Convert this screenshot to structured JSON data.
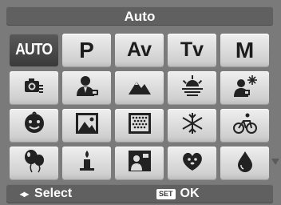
{
  "header": {
    "title": "Auto"
  },
  "modes": [
    {
      "label": "AUTO",
      "selected": true
    },
    {
      "label": "P"
    },
    {
      "label": "Av"
    },
    {
      "label": "Tv"
    },
    {
      "label": "M"
    }
  ],
  "scene_icons": [
    "camera-settings-icon",
    "portrait-icon",
    "landscape-icon",
    "sunset-icon",
    "night-portrait-icon",
    "baby-face-icon",
    "landscape-frame-icon",
    "pattern-icon",
    "snow-icon",
    "cycling-icon",
    "party-icon",
    "candlelight-icon",
    "self-portrait-icon",
    "pet-icon",
    "underwater-drop-icon"
  ],
  "footer": {
    "select_label": "Select",
    "arrow_glyph": "◂▸",
    "set_badge": "SET",
    "ok_label": "OK"
  }
}
